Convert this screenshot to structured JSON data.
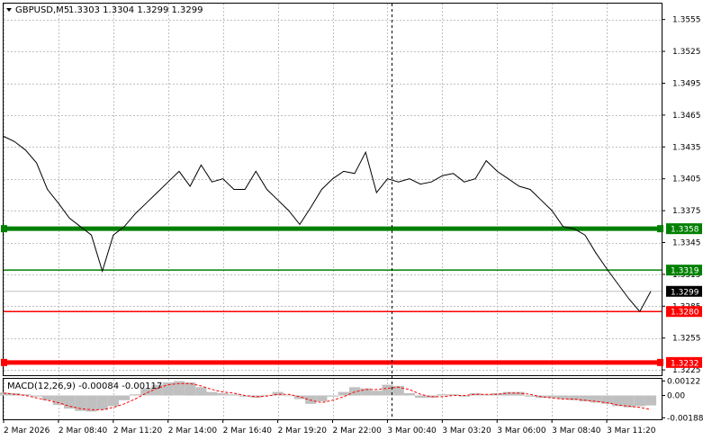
{
  "header": {
    "symbol": "GBPUSD,M5",
    "ohlc": "1.3303 1.3304 1.3299 1.3299"
  },
  "macd": {
    "label": "MACD(12,26,9) -0.00084 -0.00117",
    "ticks": [
      "0.00122",
      "0.00",
      "-0.00188"
    ]
  },
  "price_axis": {
    "ticks": [
      "1.3555",
      "1.3525",
      "1.3495",
      "1.3465",
      "1.3435",
      "1.3405",
      "1.3375",
      "1.3345",
      "1.3315",
      "1.3285",
      "1.3255",
      "1.3225"
    ]
  },
  "levels": [
    {
      "price": 1.3358,
      "label": "1.3358",
      "color": "#008000",
      "thick": true
    },
    {
      "price": 1.3319,
      "label": "1.3319",
      "color": "#008000",
      "thick": false
    },
    {
      "price": 1.3299,
      "label": "1.3299",
      "color": "#000000",
      "thick": false,
      "current": true
    },
    {
      "price": 1.328,
      "label": "1.3280",
      "color": "#ff0000",
      "thick": false
    },
    {
      "price": 1.3232,
      "label": "1.3232",
      "color": "#ff0000",
      "thick": true
    }
  ],
  "time_axis": {
    "ticks": [
      "2 Mar 2026",
      "2 Mar 08:40",
      "2 Mar 11:20",
      "2 Mar 14:00",
      "2 Mar 16:40",
      "2 Mar 19:20",
      "2 Mar 22:00",
      "3 Mar 00:40",
      "3 Mar 03:20",
      "3 Mar 06:00",
      "3 Mar 08:40",
      "3 Mar 11:20"
    ]
  },
  "colors": {
    "price_line": "#000000",
    "grid": "#c0c0c0",
    "histogram": "#c0c0c0",
    "signal": "#ff0000",
    "support": "#ff0000",
    "resistance": "#008000"
  },
  "chart_data": {
    "type": "line",
    "title": "GBPUSD,M5",
    "y": [
      1.3445,
      1.344,
      1.3432,
      1.342,
      1.3395,
      1.3382,
      1.3368,
      1.336,
      1.3352,
      1.3318,
      1.3352,
      1.336,
      1.3372,
      1.3382,
      1.3392,
      1.3402,
      1.3412,
      1.3398,
      1.3418,
      1.3402,
      1.3405,
      1.3395,
      1.3395,
      1.3412,
      1.3395,
      1.3385,
      1.3375,
      1.3362,
      1.3378,
      1.3395,
      1.3405,
      1.3412,
      1.341,
      1.343,
      1.3392,
      1.3405,
      1.3402,
      1.3405,
      1.34,
      1.3402,
      1.3408,
      1.341,
      1.3402,
      1.3405,
      1.3422,
      1.3412,
      1.3405,
      1.3398,
      1.3395,
      1.3385,
      1.3375,
      1.336,
      1.3358,
      1.3352,
      1.3335,
      1.332,
      1.3306,
      1.3292,
      1.328,
      1.3299
    ],
    "ylim": [
      1.322,
      1.357
    ],
    "macd_histogram": [
      0.00025,
      0.0002,
      0.0001,
      -0.0001,
      -0.0004,
      -0.0008,
      -0.0011,
      -0.0013,
      -0.00135,
      -0.0012,
      -0.0009,
      -0.0004,
      0.0001,
      0.0006,
      0.0009,
      0.0011,
      0.0012,
      0.0011,
      0.0007,
      0.0003,
      0.0002,
      0.0001,
      -0.0001,
      -0.0002,
      5e-05,
      0.0003,
      -5e-05,
      -0.0003,
      -0.0007,
      -0.0005,
      -0.0001,
      0.0003,
      0.0007,
      0.0006,
      0.0004,
      0.0009,
      0.0008,
      0.0002,
      -0.0002,
      -0.0002,
      0.0001,
      0.0001,
      -0.0001,
      0.0002,
      0.0001,
      0.0002,
      0.0003,
      0.0003,
      -0.0001,
      -0.0002,
      -0.0002,
      -0.0003,
      -0.0004,
      -0.0005,
      -0.0006,
      -0.0007,
      -0.0009,
      -0.001,
      -0.0009,
      -0.00084
    ],
    "macd_signal": [
      0.0002,
      0.0001,
      0.0,
      -0.0002,
      -0.0004,
      -0.0006,
      -0.0009,
      -0.0011,
      -0.0012,
      -0.0012,
      -0.001,
      -0.0007,
      -0.0003,
      0.0002,
      0.0006,
      0.0009,
      0.001,
      0.001,
      0.0008,
      0.0005,
      0.0003,
      0.0002,
      0.0,
      -0.0001,
      -5e-05,
      0.0001,
      0.0001,
      -0.0001,
      -0.0004,
      -0.0006,
      -0.0004,
      -0.0001,
      0.0003,
      0.0005,
      0.0005,
      0.0006,
      0.0007,
      0.0005,
      0.0001,
      -0.0001,
      -0.0001,
      0.0,
      0.0,
      0.0001,
      0.0001,
      0.0001,
      0.0002,
      0.0002,
      0.0001,
      -0.0001,
      -0.0002,
      -0.0003,
      -0.0003,
      -0.0004,
      -0.0005,
      -0.0006,
      -0.0008,
      -0.0009,
      -0.001,
      -0.00117
    ],
    "macd_ylim": [
      -0.002,
      0.0014
    ]
  }
}
